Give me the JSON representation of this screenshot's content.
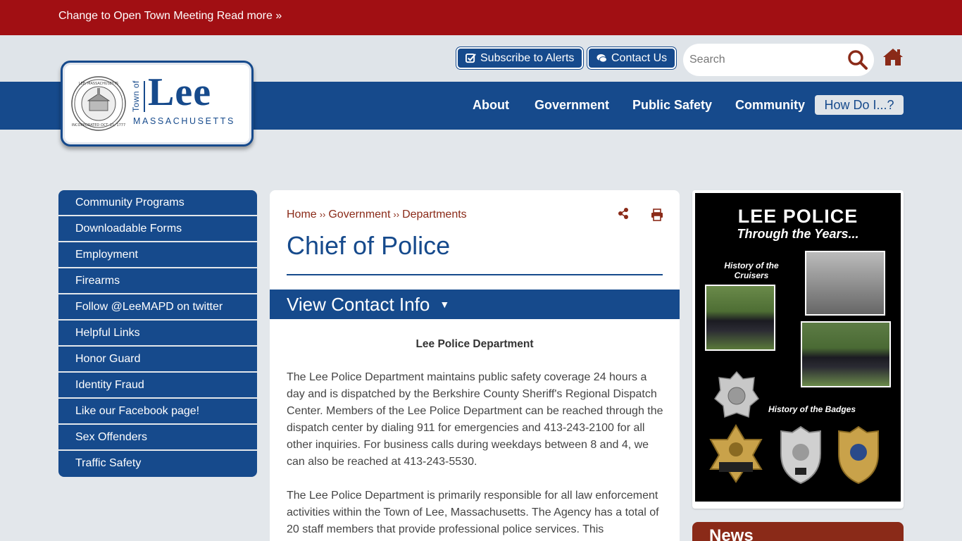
{
  "alert": {
    "text": "Change to Open Town Meeting Read more »"
  },
  "header": {
    "subscribe_label": "Subscribe to Alerts",
    "contact_label": "Contact Us",
    "search_placeholder": "Search"
  },
  "logo": {
    "town_of": "Town of",
    "name": "Lee",
    "state": "MASSACHUSETTS"
  },
  "nav": {
    "items": [
      "About",
      "Government",
      "Public Safety",
      "Community"
    ],
    "how_do_i": "How Do I...?"
  },
  "sidebar": {
    "items": [
      "Community Programs",
      "Downloadable Forms",
      "Employment",
      "Firearms",
      "Follow @LeeMAPD on twitter",
      "Helpful Links",
      "Honor Guard",
      "Identity Fraud",
      "Like our Facebook page!",
      "Sex Offenders",
      "Traffic Safety"
    ]
  },
  "content": {
    "breadcrumb": [
      "Home",
      "Government",
      "Departments"
    ],
    "breadcrumb_sep": "››",
    "title": "Chief of Police",
    "contact_toggle": "View Contact Info",
    "dept_name": "Lee Police Department",
    "para1": "The Lee Police Department maintains public safety coverage 24 hours a day and is dispatched by the Berkshire County Sheriff's Regional Dispatch Center.  Members of the Lee Police Department can be reached through the dispatch center by dialing 911 for emergencies and 413-243-2100 for all other inquiries.  For business calls during weekdays between 8 and 4, we can also be reached at  413-243-5530.",
    "para2": "The Lee Police Department is primarily responsible for all law enforcement activities within the Town of Lee, Massachusetts.  The Agency has a total of 20 staff members that provide professional police services.  This"
  },
  "promo": {
    "title": "LEE POLICE",
    "subtitle": "Through the Years...",
    "cruisers_caption": "History of the Cruisers",
    "badges_caption": "History of the Badges"
  },
  "news": {
    "title": "News"
  },
  "colors": {
    "brand_blue": "#164a8c",
    "alert_red": "#a10f13",
    "accent_brown": "#8a2a18"
  }
}
